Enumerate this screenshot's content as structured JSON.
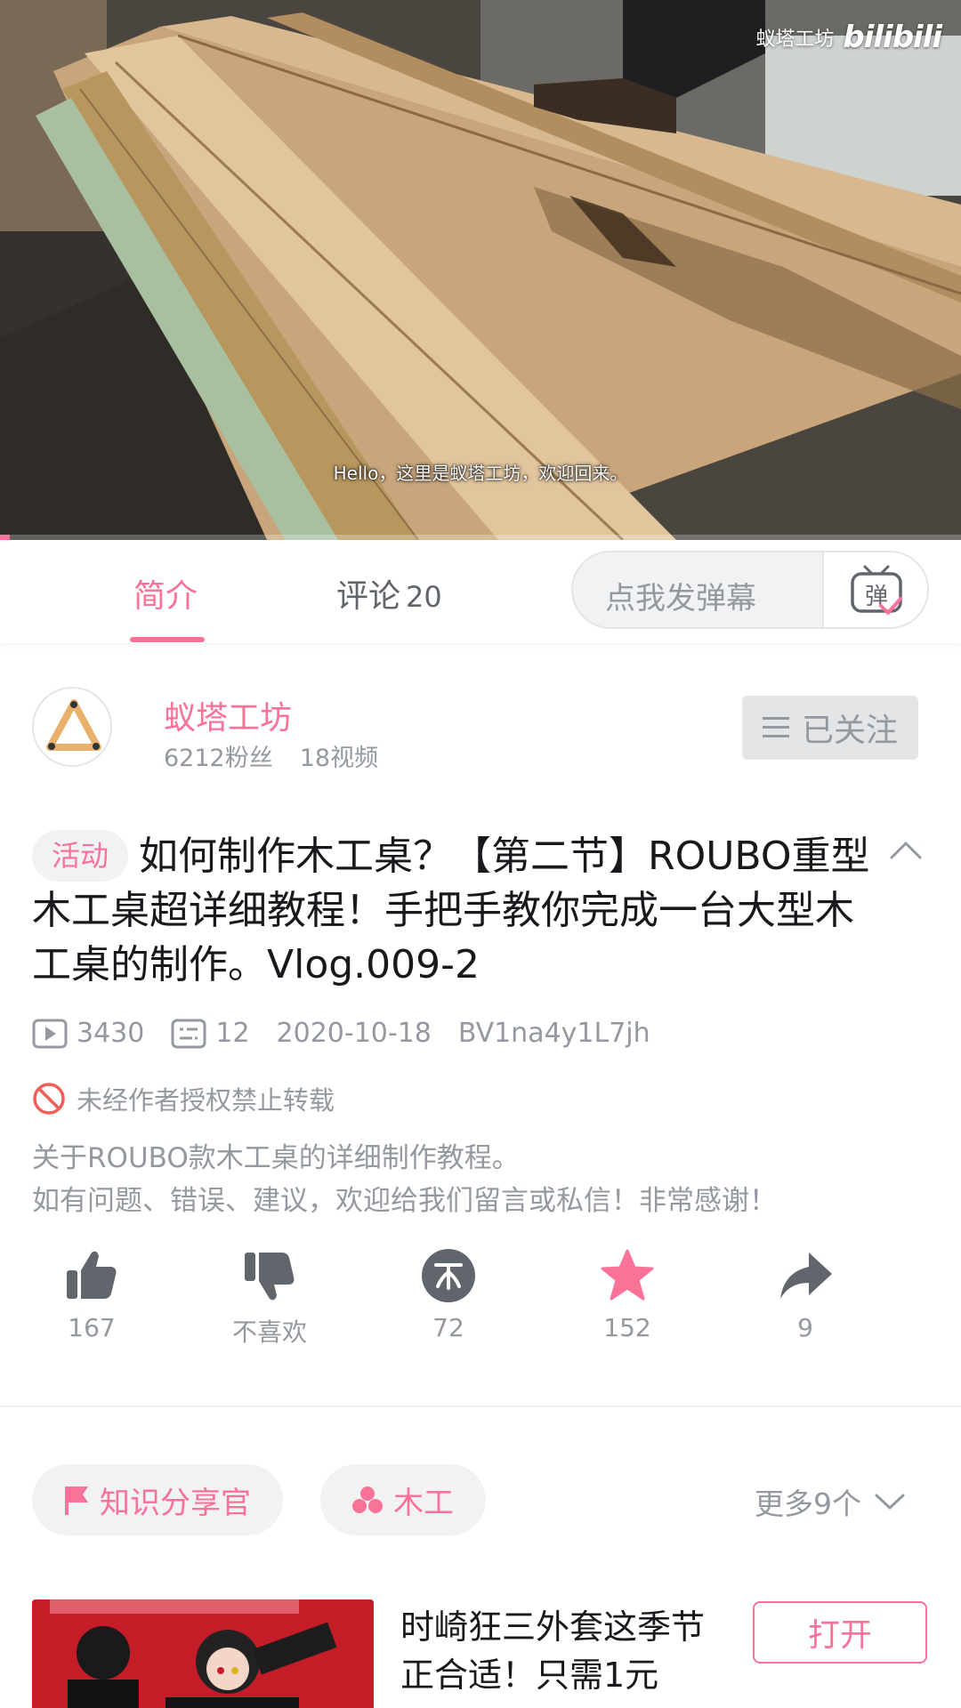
{
  "video": {
    "watermark_text": "蚁塔工坊",
    "watermark_logo": "bilibili",
    "subtitle": "Hello，这里是蚁塔工坊，欢迎回来。",
    "progress_fraction": 0.01
  },
  "tabs": {
    "intro": "简介",
    "comments": "评论",
    "comments_count": "20"
  },
  "danmaku": {
    "placeholder": "点我发弹幕",
    "button_icon": "danmaku-send-icon"
  },
  "uploader": {
    "name": "蚁塔工坊",
    "fans": "6212粉丝",
    "videos": "18视频",
    "follow_label": "已关注"
  },
  "video_info": {
    "activity_tag": "活动",
    "title": "如何制作木工桌？【第二节】ROUBO重型木工桌超详细教程！手把手教你完成一台大型木工桌的制作。Vlog.009-2",
    "views": "3430",
    "danmaku_count": "12",
    "date": "2020-10-18",
    "bvid": "BV1na4y1L7jh",
    "copyright_notice": "未经作者授权禁止转载",
    "description_line1": "关于ROUBO款木工桌的详细制作教程。",
    "description_line2": "如有问题、错误、建议，欢迎给我们留言或私信！非常感谢！"
  },
  "actions": {
    "like": "167",
    "dislike": "不喜欢",
    "coin": "72",
    "favorite": "152",
    "share": "9"
  },
  "tags": {
    "tag1": "知识分享官",
    "tag2": "木工",
    "more": "更多9个"
  },
  "ad": {
    "title": "时崎狂三外套这季节正合适！只需1元",
    "open_label": "打开"
  },
  "colors": {
    "accent": "#fb7299",
    "text_primary": "#18191c",
    "text_secondary": "#9499a0",
    "bg_gray": "#f1f2f3"
  }
}
